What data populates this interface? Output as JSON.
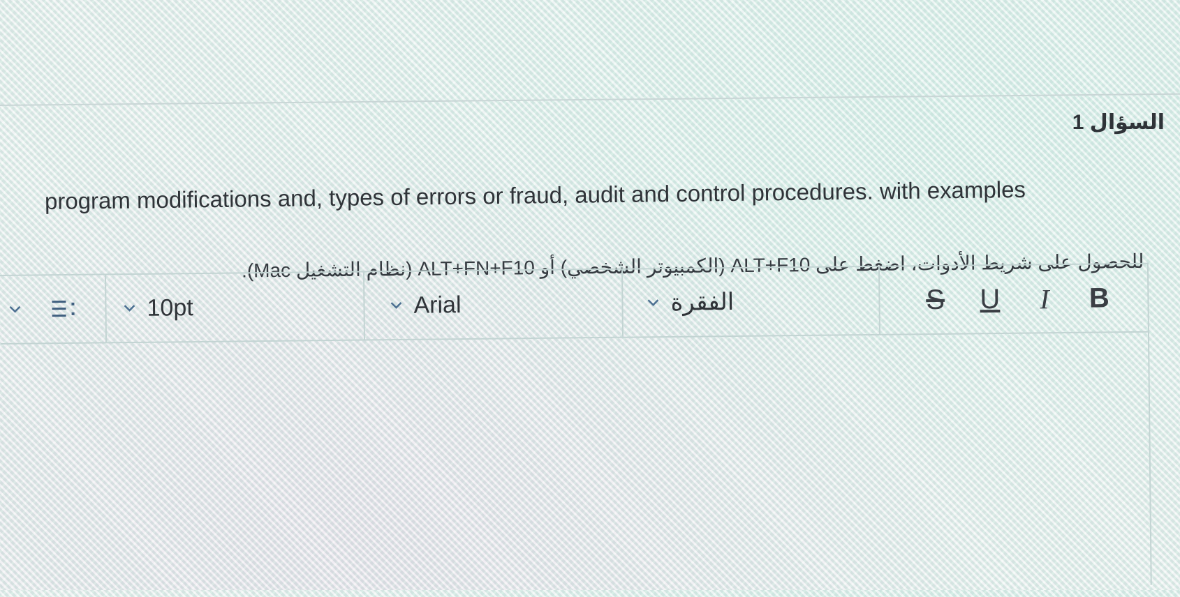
{
  "question": {
    "label": "السؤال 1",
    "text": "program modifications and, types of errors or fraud, audit and control procedures. with examples",
    "toolbar_hint": "للحصول على شريط الأدوات، اضغط على ALT+F10 (الكمبيوتر الشخصي) أو ALT+FN+F10 (نظام التشغيل Mac)."
  },
  "toolbar": {
    "list_icon": "list-options-icon",
    "font_size": "10pt",
    "font_family": "Arial",
    "paragraph_style": "الفقرة",
    "format_buttons": {
      "bold": "B",
      "italic": "I",
      "underline": "U",
      "strikethrough": "S"
    }
  },
  "editor": {
    "content": ""
  },
  "colors": {
    "chevron": "#4b6f91",
    "border": "#c3d4d3",
    "text": "#2f3338"
  }
}
